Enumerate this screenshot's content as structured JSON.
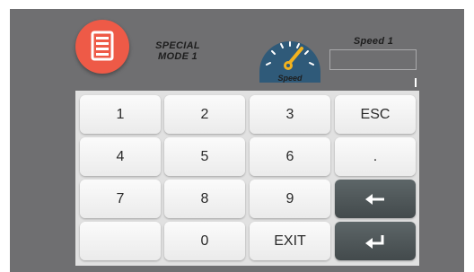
{
  "header": {
    "mode_label_line1": "SPECIAL",
    "mode_label_line2": "MODE 1",
    "mode_icon": "document-icon",
    "gauge_icon": "speedometer-icon",
    "gauge_label": "Speed",
    "speed_title": "Speed 1",
    "speed_value": ""
  },
  "keypad": {
    "k1": "1",
    "k2": "2",
    "k3": "3",
    "esc": "ESC",
    "k4": "4",
    "k5": "5",
    "k6": "6",
    "dot": ".",
    "k7": "7",
    "k8": "8",
    "k9": "9",
    "backspace_icon": "arrow-left-icon",
    "blank": "",
    "k0": "0",
    "exit": "EXIT",
    "enter_icon": "enter-icon"
  },
  "colors": {
    "screen_background": "#6f6f71",
    "mode_icon_red": "#ee5a47",
    "gauge_blue": "#2f5a79",
    "gauge_needle": "#f2b21e",
    "dark_key": "#4b5355",
    "keypad_background": "#e1e1e1"
  }
}
